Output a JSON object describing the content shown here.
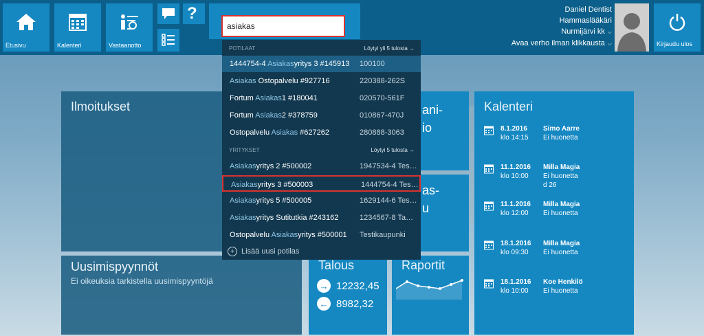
{
  "nav": {
    "home_label": "Etusivu",
    "calendar_label": "Kalenteri",
    "reception_label": "Vastaanotto"
  },
  "search": {
    "value": "asiakas"
  },
  "user": {
    "name": "Daniel Dentist",
    "role": "Hammaslääkäri",
    "location": "Nurmijärvi kk",
    "curtain": "Avaa verho ilman klikkausta",
    "logout_label": "Kirjaudu ulos"
  },
  "dropdown": {
    "patients_header": "POTILAAT",
    "patients_found": "Löytyi yli 5 tulosta →",
    "patients": [
      {
        "pre": "1444754-4 ",
        "hit": "Asiakas",
        "post": "yritys 3 #145913",
        "code": "100100"
      },
      {
        "pre": "",
        "hit": "Asiakas",
        "post": " Ostopalvelu #927716",
        "code": "220388-262S"
      },
      {
        "pre": "Fortum ",
        "hit": "Asiakas",
        "post": "1 #180041",
        "code": "020570-561F"
      },
      {
        "pre": "Fortum ",
        "hit": "Asiakas",
        "post": "2 #378759",
        "code": "010867-470J"
      },
      {
        "pre": "Ostopalvelu ",
        "hit": "Asiakas",
        "post": " #627262",
        "code": "280888-3063"
      }
    ],
    "companies_header": "YRITYKSET",
    "companies_found": "Löytyi 5 tulosta →",
    "companies": [
      {
        "pre": "",
        "hit": "Asiakas",
        "post": "yritys 2 #500002",
        "code": "1947534-4  Tes…"
      },
      {
        "pre": "",
        "hit": "Asiakas",
        "post": "yritys 3 #500003",
        "code": "1444754-4  Tes…"
      },
      {
        "pre": "",
        "hit": "Asiakas",
        "post": "yritys 5 #500005",
        "code": "1629144-6  Tes…"
      },
      {
        "pre": "",
        "hit": "Asiakas",
        "post": "yritys Sutitutkia #243162",
        "code": "1234567-8  Ta…"
      },
      {
        "pre": "Ostopalvelu ",
        "hit": "Asiakas",
        "post": "yritys #500001",
        "code": "Testikaupunki"
      }
    ],
    "add_new": "Lisää uusi potilas"
  },
  "tiles": {
    "notices_title": "Ilmoitukset",
    "renewals_title": "Uusimispyynnöt",
    "renewals_sub": "Ei oikeuksia tarkistella uusimispyyntöjä",
    "mid1_partial": "ani-\nio",
    "mid2_partial": "as-\nu",
    "finance_title": "Talous",
    "finance_in": "12232,45",
    "finance_out": "8982,32",
    "reports_title": "Raportit",
    "calendar_title": "Kalenteri"
  },
  "calendar": [
    {
      "date": "8.1.2016",
      "time": "klo 14:15",
      "person": "Simo Aarre",
      "room": "Ei huonetta",
      "extra": ""
    },
    {
      "date": "11.1.2016",
      "time": "klo 10:00",
      "person": "Milla Magia",
      "room": "Ei huonetta",
      "extra": "d 26"
    },
    {
      "date": "11.1.2016",
      "time": "klo 12:00",
      "person": "Milla Magia",
      "room": "Ei huonetta",
      "extra": ""
    },
    {
      "date": "18.1.2016",
      "time": "klo 09:30",
      "person": "Milla Magia",
      "room": "Ei huonetta",
      "extra": ""
    },
    {
      "date": "18.1.2016",
      "time": "klo 10:00",
      "person": "Koe Henkilö",
      "room": "Ei huonetta",
      "extra": ""
    }
  ],
  "colors": {
    "tile_blue": "#1588c2",
    "topbar": "#0b5f8a",
    "dropdown_bg": "#12384f",
    "highlight": "#d9322e"
  }
}
